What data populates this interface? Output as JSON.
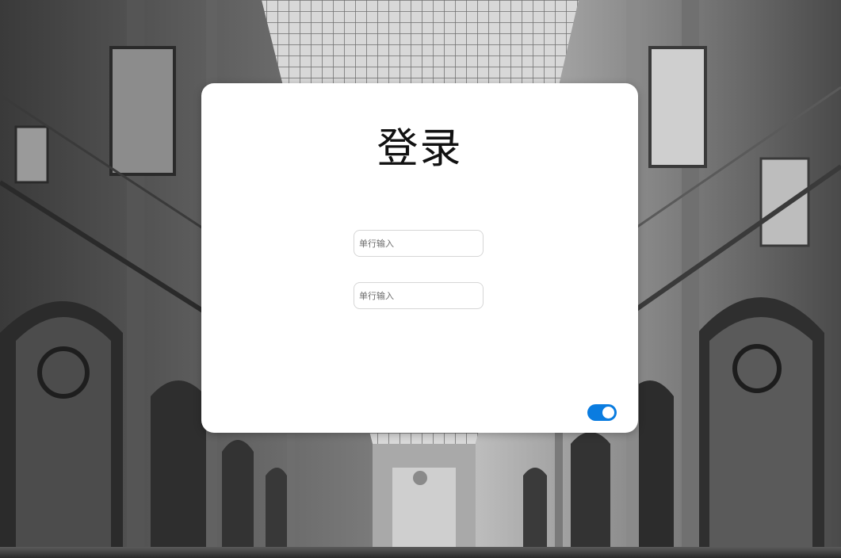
{
  "login": {
    "title": "登录",
    "username_placeholder": "单行输入",
    "password_placeholder": "单行输入",
    "toggle_state": "on"
  },
  "colors": {
    "card_background": "#ffffff",
    "toggle_on": "#0a7ce0",
    "field_border": "#d6d6d6"
  }
}
